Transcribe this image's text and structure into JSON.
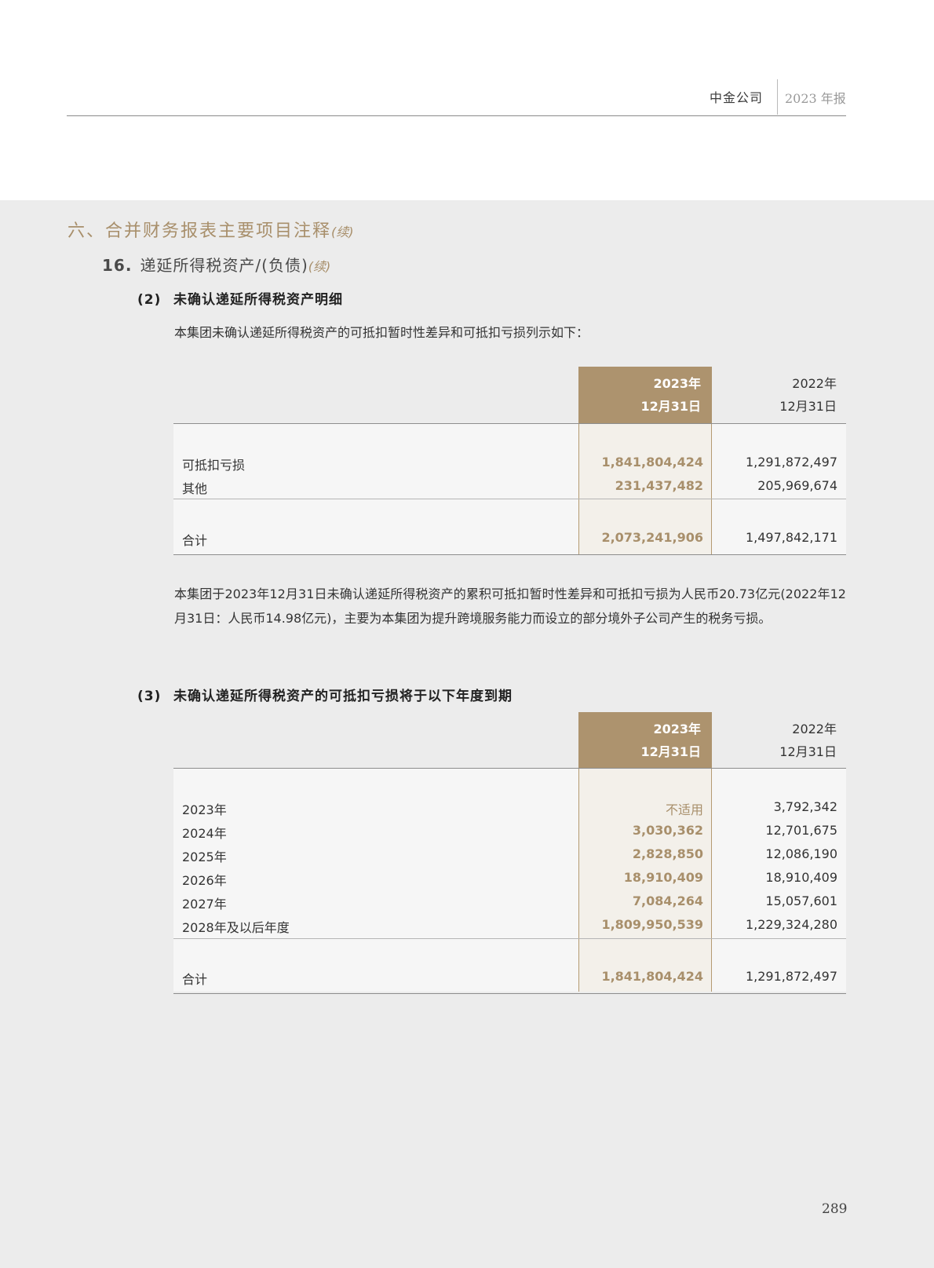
{
  "header": {
    "company": "中金公司",
    "report": "2023 年报"
  },
  "section": {
    "title": "六、合并财务报表主要项目注释",
    "continued": "(续)"
  },
  "subsection": {
    "number": "16.",
    "title": "递延所得税资产/(负债)",
    "continued": "(续)"
  },
  "item2": {
    "number": "(2)",
    "title": "未确认递延所得税资产明细",
    "intro": "本集团未确认递延所得税资产的可抵扣暂时性差异和可抵扣亏损列示如下：",
    "col_2023_line1": "2023年",
    "col_2023_line2": "12月31日",
    "col_2022_line1": "2022年",
    "col_2022_line2": "12月31日",
    "rows": [
      {
        "label": "可抵扣亏损",
        "v2023": "1,841,804,424",
        "v2022": "1,291,872,497"
      },
      {
        "label": "其他",
        "v2023": "231,437,482",
        "v2022": "205,969,674"
      }
    ],
    "total": {
      "label": "合计",
      "v2023": "2,073,241,906",
      "v2022": "1,497,842,171"
    },
    "note": "本集团于2023年12月31日未确认递延所得税资产的累积可抵扣暂时性差异和可抵扣亏损为人民币20.73亿元(2022年12月31日：人民币14.98亿元)，主要为本集团为提升跨境服务能力而设立的部分境外子公司产生的税务亏损。"
  },
  "item3": {
    "number": "(3)",
    "title": "未确认递延所得税资产的可抵扣亏损将于以下年度到期",
    "col_2023_line1": "2023年",
    "col_2023_line2": "12月31日",
    "col_2022_line1": "2022年",
    "col_2022_line2": "12月31日",
    "rows": [
      {
        "label": "2023年",
        "v2023": "不适用",
        "v2022": "3,792,342"
      },
      {
        "label": "2024年",
        "v2023": "3,030,362",
        "v2022": "12,701,675"
      },
      {
        "label": "2025年",
        "v2023": "2,828,850",
        "v2022": "12,086,190"
      },
      {
        "label": "2026年",
        "v2023": "18,910,409",
        "v2022": "18,910,409"
      },
      {
        "label": "2027年",
        "v2023": "7,084,264",
        "v2022": "15,057,601"
      },
      {
        "label": "2028年及以后年度",
        "v2023": "1,809,950,539",
        "v2022": "1,229,324,280"
      }
    ],
    "total": {
      "label": "合计",
      "v2023": "1,841,804,424",
      "v2022": "1,291,872,497"
    }
  },
  "page_number": "289"
}
